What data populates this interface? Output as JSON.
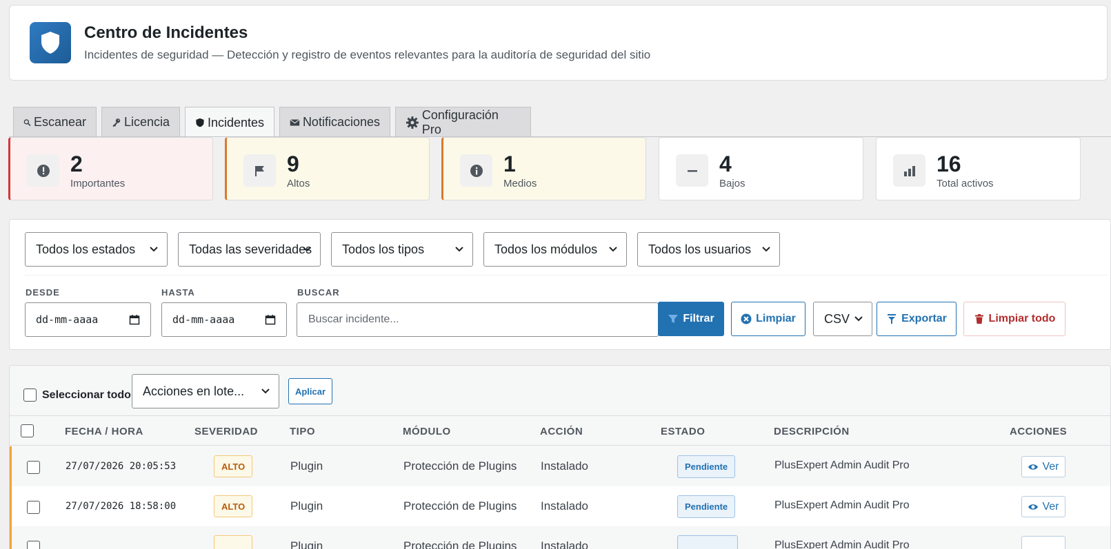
{
  "header": {
    "title": "Centro de Incidentes",
    "subtitle": "Incidentes de seguridad — Detección y registro de eventos relevantes para la auditoría de seguridad del sitio",
    "logo_icon": "shield-icon"
  },
  "tabs": [
    {
      "label": "Escanear",
      "icon": "search-icon"
    },
    {
      "label": "Licencia",
      "icon": "key-icon"
    },
    {
      "label": "Incidentes",
      "icon": "shield-icon",
      "active": true
    },
    {
      "label": "Notificaciones",
      "icon": "envelope-icon"
    },
    {
      "label": "Configuración Pro",
      "icon": "gear-icon"
    }
  ],
  "stats": [
    {
      "value": "2",
      "label": "Importantes",
      "icon": "alert-icon",
      "color": "#d63638"
    },
    {
      "value": "9",
      "label": "Altos",
      "icon": "flag-icon",
      "color": "#d97a2b"
    },
    {
      "value": "1",
      "label": "Medios",
      "icon": "info-icon",
      "color": "#d97a2b"
    },
    {
      "value": "4",
      "label": "Bajos",
      "icon": "minus-icon"
    },
    {
      "value": "16",
      "label": "Total activos",
      "icon": "bar-chart-icon"
    }
  ],
  "filters": {
    "status": "Todos los estados",
    "severity": "Todas las severidades",
    "type": "Todos los tipos",
    "module": "Todos los módulos",
    "user": "Todos los usuarios",
    "from_label": "DESDE",
    "from_placeholder": "dd-mm-aaaa",
    "to_label": "HASTA",
    "to_placeholder": "dd-mm-aaaa",
    "search_label": "BUSCAR",
    "search_placeholder": "Buscar incidente...",
    "filter_btn": "Filtrar",
    "clear_btn": "Limpiar",
    "format": "CSV",
    "export_btn": "Exportar",
    "clear_all_btn": "Limpiar todo"
  },
  "bulk": {
    "select_all": "Seleccionar todo",
    "actions": "Acciones en lote...",
    "apply": "Aplicar"
  },
  "table": {
    "headers": [
      "FECHA / HORA",
      "SEVERIDAD",
      "TIPO",
      "MÓDULO",
      "ACCIÓN",
      "ESTADO",
      "DESCRIPCIÓN",
      "ACCIONES"
    ],
    "rows": [
      {
        "datetime": "27/07/2026 20:05:53",
        "severity": "ALTO",
        "type": "Plugin",
        "module": "Protección de Plugins",
        "action": "Instalado",
        "status": "Pendiente",
        "description": "PlusExpert Admin Audit Pro",
        "view": "Ver"
      },
      {
        "datetime": "27/07/2026 18:58:00",
        "severity": "ALTO",
        "type": "Plugin",
        "module": "Protección de Plugins",
        "action": "Instalado",
        "status": "Pendiente",
        "description": "PlusExpert Admin Audit Pro",
        "view": "Ver"
      },
      {
        "datetime": "",
        "severity": "",
        "type": "Plugin",
        "module": "Protección de Plugins",
        "action": "Instalado",
        "status": "",
        "description": "PlusExpert Admin Audit Pro",
        "view": ""
      }
    ]
  }
}
